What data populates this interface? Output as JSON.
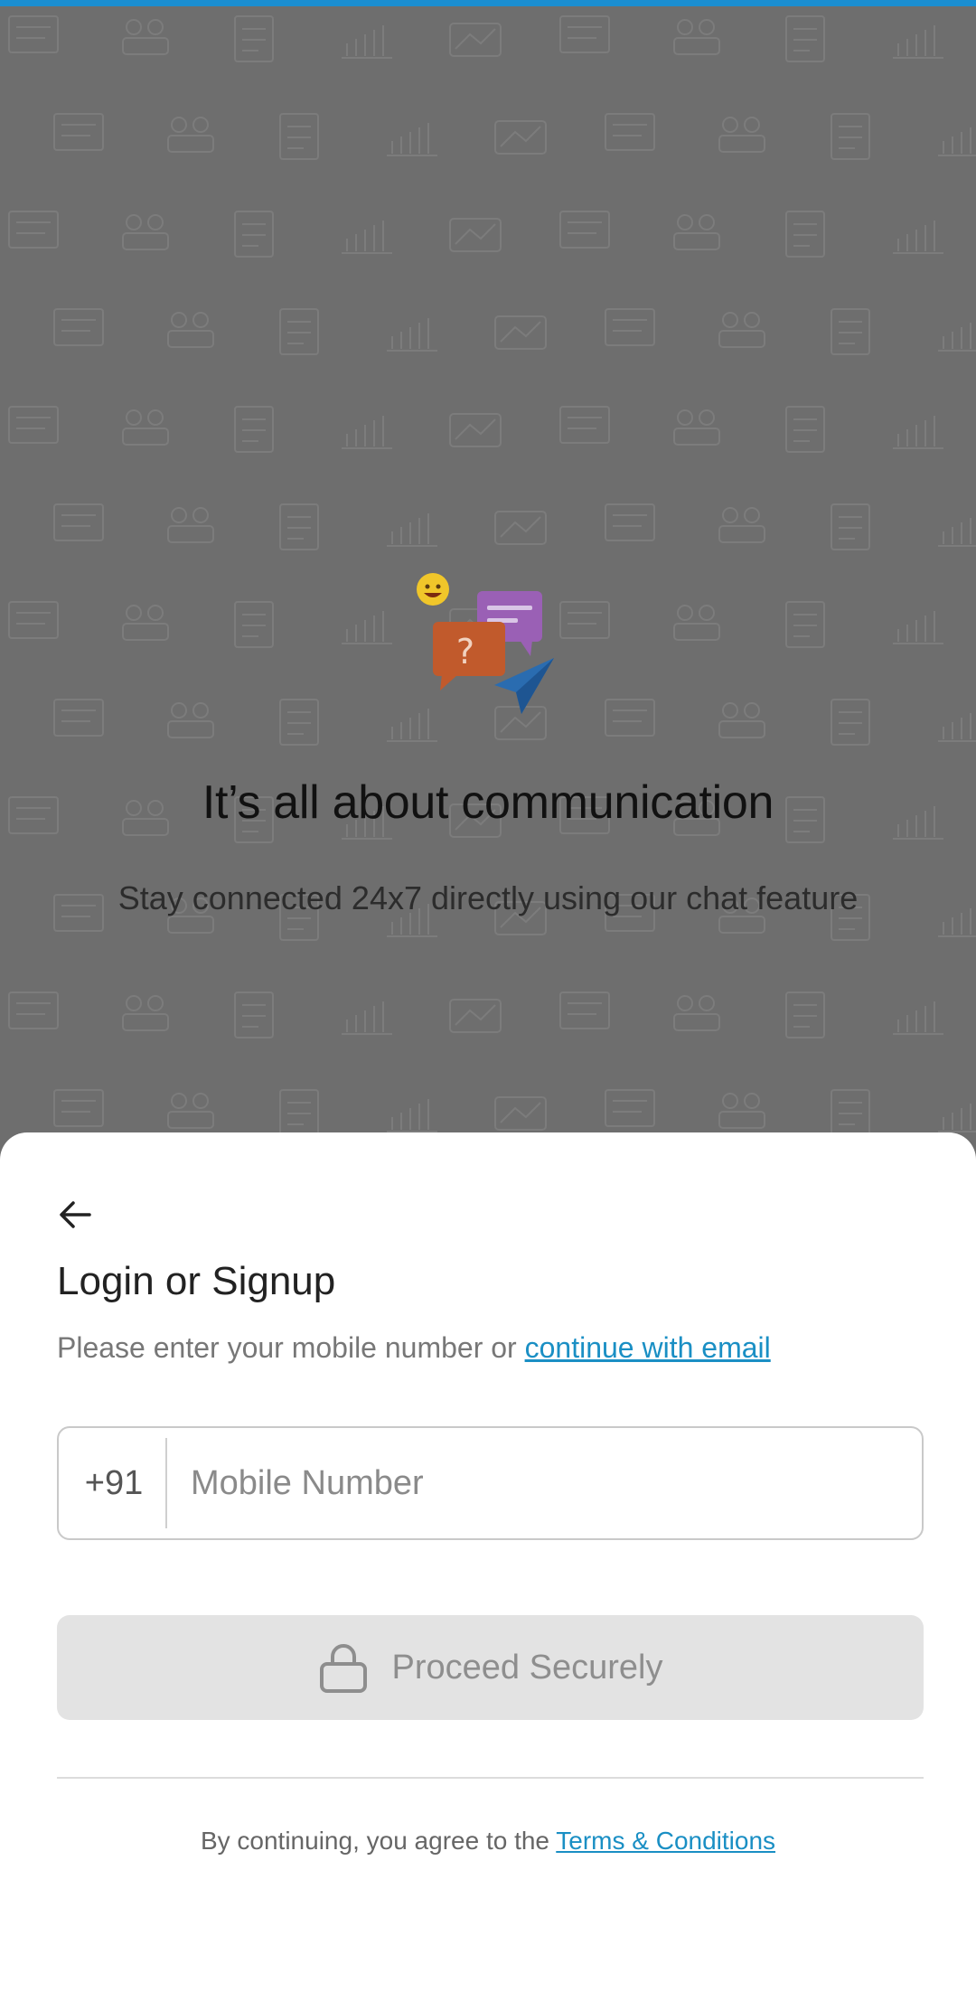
{
  "hero": {
    "title": "It’s all about communication",
    "subtitle": "Stay connected 24x7 directly using our chat feature",
    "illustration_icon": "chat-bubbles-icon"
  },
  "login": {
    "title": "Login or Signup",
    "subtitle_prefix": "Please enter your mobile number or ",
    "email_link": "continue with email",
    "country_code": "+91",
    "mobile_placeholder": "Mobile Number",
    "mobile_value": "",
    "proceed_label": "Proceed Securely",
    "terms_prefix": "By continuing, you agree to the ",
    "terms_link": "Terms & Conditions"
  },
  "colors": {
    "accent": "#1b8ed1",
    "link": "#1a8fc4",
    "disabled_button": "#e3e3e3",
    "overlay": "#6e6e6e"
  }
}
